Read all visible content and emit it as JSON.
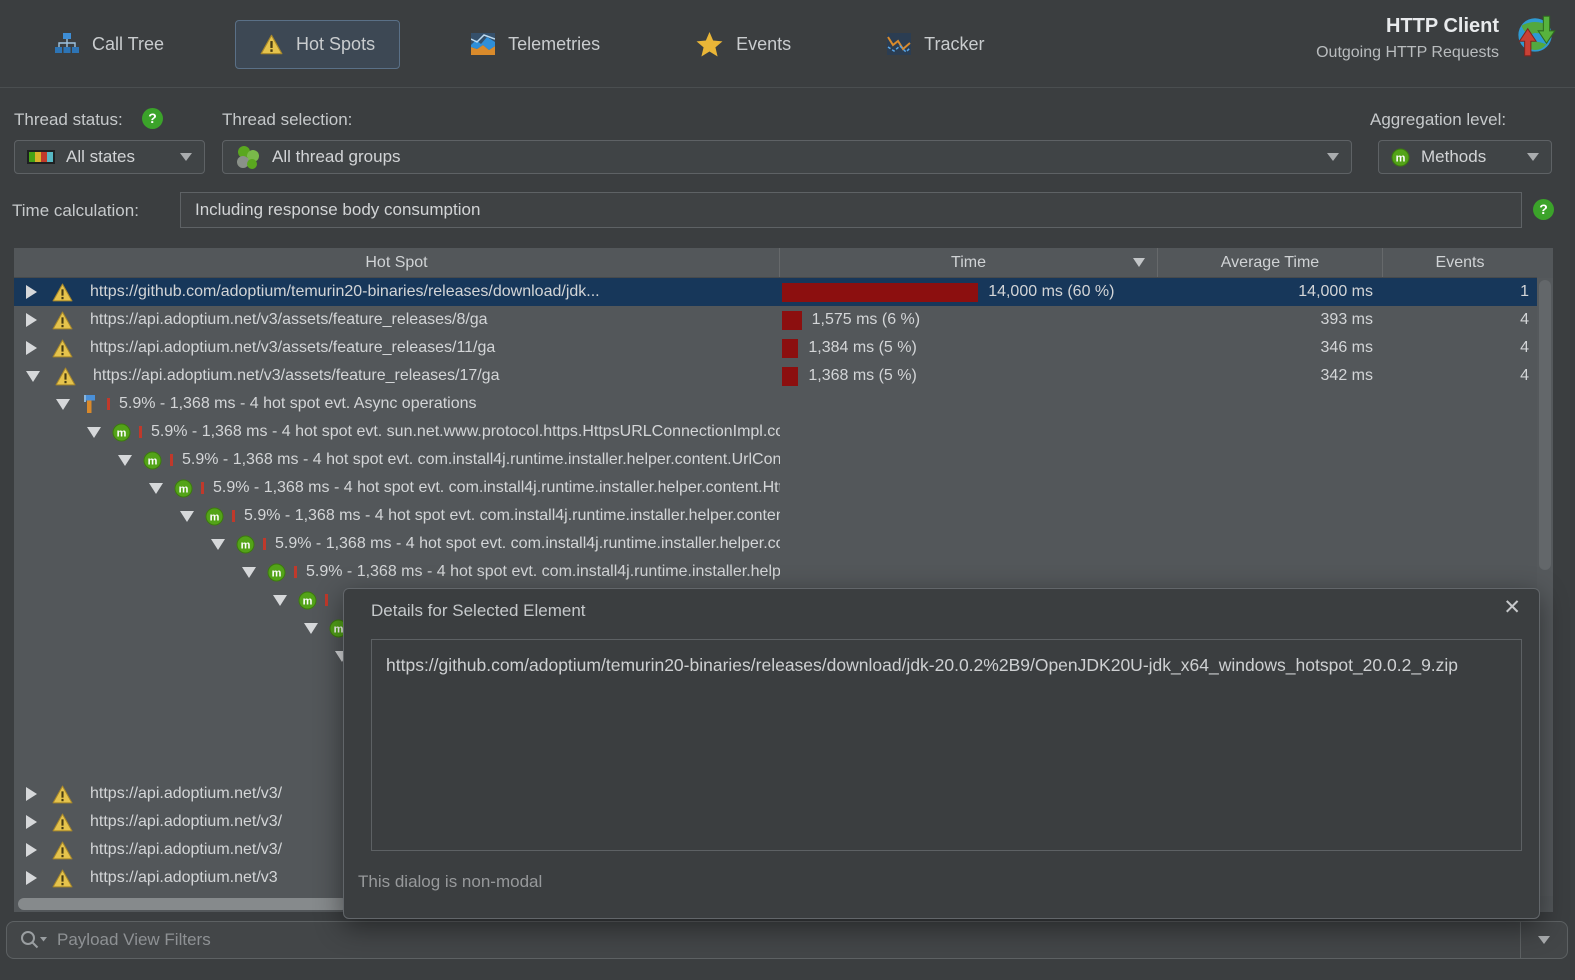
{
  "tabs": [
    {
      "label": "Call Tree",
      "icon": "call-tree-icon",
      "selected": false
    },
    {
      "label": "Hot Spots",
      "icon": "hot-spots-icon",
      "selected": true
    },
    {
      "label": "Telemetries",
      "icon": "telemetries-icon",
      "selected": false
    },
    {
      "label": "Events",
      "icon": "events-icon",
      "selected": false
    },
    {
      "label": "Tracker",
      "icon": "tracker-icon",
      "selected": false
    }
  ],
  "probe": {
    "title": "HTTP Client",
    "subtitle": "Outgoing HTTP Requests",
    "icon": "http-client-globe-icon"
  },
  "filters": {
    "thread_status_label": "Thread status:",
    "thread_status_value": "All states",
    "thread_status_icon": "thread-states-icon",
    "thread_selection_label": "Thread selection:",
    "thread_selection_value": "All thread groups",
    "thread_selection_icon": "thread-groups-icon",
    "aggregation_label": "Aggregation level:",
    "aggregation_value": "Methods",
    "aggregation_icon": "method-icon",
    "time_calculation_label": "Time calculation:",
    "time_calculation_value": "Including response body consumption"
  },
  "table": {
    "columns": [
      "Hot Spot",
      "Time",
      "Average Time",
      "Events"
    ],
    "sort": {
      "column": "Time",
      "direction": "desc"
    },
    "url_rows": [
      {
        "selected": true,
        "expanded": false,
        "text": "https://github.com/adoptium/temurin20-binaries/releases/download/jdk...",
        "time": "14,000 ms (60 %)",
        "pct": 60,
        "avg": "14,000 ms",
        "events": "1"
      },
      {
        "selected": false,
        "expanded": false,
        "text": "https://api.adoptium.net/v3/assets/feature_releases/8/ga",
        "time": "1,575 ms (6 %)",
        "pct": 6,
        "avg": "393 ms",
        "events": "4"
      },
      {
        "selected": false,
        "expanded": false,
        "text": "https://api.adoptium.net/v3/assets/feature_releases/11/ga",
        "time": "1,384 ms (5 %)",
        "pct": 5,
        "avg": "346 ms",
        "events": "4"
      },
      {
        "selected": false,
        "expanded": true,
        "text": "https://api.adoptium.net/v3/assets/feature_releases/17/ga",
        "time": "1,368 ms (5 %)",
        "pct": 5,
        "avg": "342 ms",
        "events": "4"
      }
    ],
    "tree_rows": [
      {
        "depth": 1,
        "icon": "async-operations-icon",
        "text": "5.9% - 1,368 ms - 4 hot spot evt. Async operations"
      },
      {
        "depth": 2,
        "icon": "method-icon",
        "text": "5.9% - 1,368 ms - 4 hot spot evt. sun.net.www.protocol.https.HttpsURLConnectionImpl.connect"
      },
      {
        "depth": 3,
        "icon": "method-icon",
        "text": "5.9% - 1,368 ms - 4 hot spot evt. com.install4j.runtime.installer.helper.content.UrlConnectionWrapper.connect"
      },
      {
        "depth": 4,
        "icon": "method-icon",
        "text": "5.9% - 1,368 ms - 4 hot spot evt. com.install4j.runtime.installer.helper.content.HttpRequestHandler.getURLConnection"
      },
      {
        "depth": 5,
        "icon": "method-icon",
        "text": "5.9% - 1,368 ms - 4 hot spot evt. com.install4j.runtime.installer.helper.content.HttpRequestHandler.createJavaConnection"
      },
      {
        "depth": 6,
        "icon": "method-icon",
        "text": "5.9% - 1,368 ms - 4 hot spot evt. com.install4j.runtime.installer.helper.content.HttpRequestHandler.connect"
      },
      {
        "depth": 7,
        "icon": "method-icon",
        "text": "5.9% - 1,368 ms - 4 hot spot evt. com.install4j.runtime.installer.helper.content.TextRequestHandler.connect"
      },
      {
        "depth": 8,
        "icon": "method-icon",
        "text": ""
      },
      {
        "depth": 9,
        "icon": "method-icon",
        "text": ""
      },
      {
        "depth": 10,
        "icon": "",
        "text": ""
      }
    ],
    "bottom_rows": [
      {
        "text": "https://api.adoptium.net/v3/"
      },
      {
        "text": "https://api.adoptium.net/v3/"
      },
      {
        "text": "https://api.adoptium.net/v3/"
      },
      {
        "text": "https://api.adoptium.net/v3"
      }
    ]
  },
  "dialog": {
    "title": "Details for Selected Element",
    "content": "https://github.com/adoptium/temurin20-binaries/releases/download/jdk-20.0.2%2B9/OpenJDK20U-jdk_x64_windows_hotspot_20.0.2_9.zip",
    "footer": "This dialog is non-modal"
  },
  "search": {
    "placeholder": "Payload View Filters"
  },
  "colors": {
    "selected_row": "#17375a",
    "hotspot_bar": "#8c0f0f",
    "warning_yellow": "#e5c34c",
    "method_green": "#53a318",
    "help_green": "#3ba32a"
  }
}
